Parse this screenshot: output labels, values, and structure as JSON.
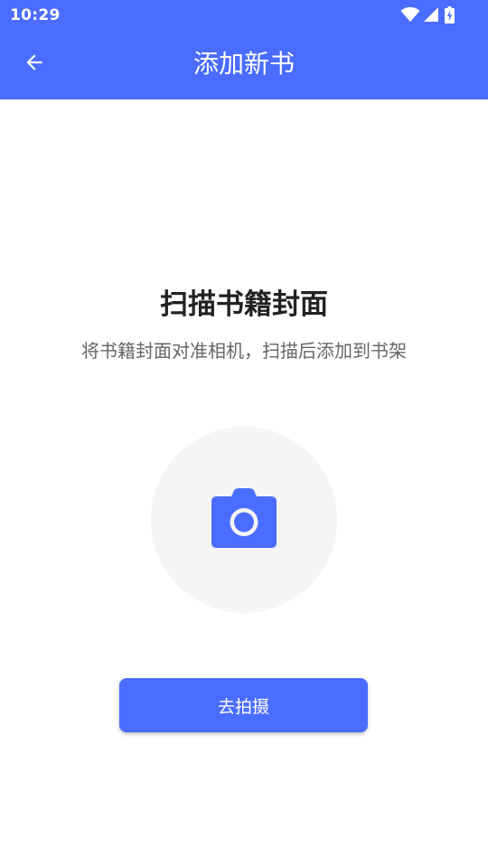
{
  "status_bar": {
    "time": "10:29",
    "icons": [
      "wifi-icon",
      "signal-icon",
      "battery-charging-icon"
    ]
  },
  "app_bar": {
    "back_icon": "arrow-left-icon",
    "title": "添加新书"
  },
  "main": {
    "headline": "扫描书籍封面",
    "subtitle": "将书籍封面对准相机，扫描后添加到书架",
    "camera_icon": "camera-icon",
    "shoot_button_label": "去拍摄"
  },
  "colors": {
    "primary": "#4a6cff",
    "circle_bg": "#f5f5f5",
    "headline": "#222222",
    "subtitle": "#666666"
  }
}
